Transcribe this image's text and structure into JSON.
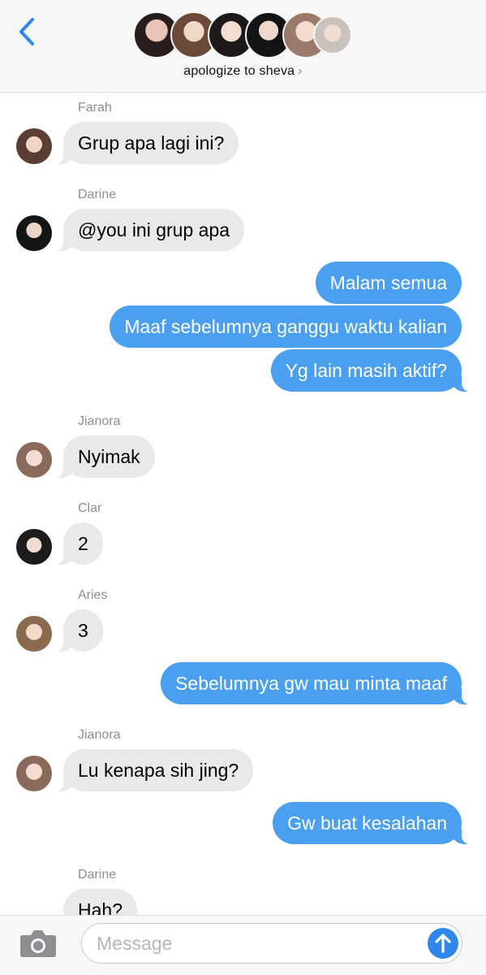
{
  "header": {
    "group_name": "apologize to sheva",
    "chevron": "›",
    "back_icon": "chevron-left-icon"
  },
  "messages": [
    {
      "sender": "Farah",
      "text": "Grup apa lagi ini?",
      "direction": "incoming"
    },
    {
      "sender": "Darine",
      "text": "@you ini grup apa",
      "direction": "incoming"
    },
    {
      "text": "Malam semua",
      "direction": "outgoing"
    },
    {
      "text": "Maaf sebelumnya ganggu waktu kalian",
      "direction": "outgoing"
    },
    {
      "text": "Yg lain masih aktif?",
      "direction": "outgoing"
    },
    {
      "sender": "Jianora",
      "text": "Nyimak",
      "direction": "incoming"
    },
    {
      "sender": "Clar",
      "text": "2",
      "direction": "incoming"
    },
    {
      "sender": "Aries",
      "text": "3",
      "direction": "incoming"
    },
    {
      "text": "Sebelumnya gw mau minta maaf",
      "direction": "outgoing"
    },
    {
      "sender": "Jianora",
      "text": "Lu kenapa sih jing?",
      "direction": "incoming"
    },
    {
      "text": "Gw buat kesalahan",
      "direction": "outgoing"
    },
    {
      "sender": "Darine",
      "text": "Hah?",
      "direction": "incoming"
    }
  ],
  "input": {
    "placeholder": "Message",
    "camera_icon": "camera-icon",
    "send_icon": "arrow-up-icon"
  },
  "colors": {
    "outgoing_bubble": "#4a9ff0",
    "incoming_bubble": "#e9e9eb",
    "accent": "#2f86eb"
  }
}
